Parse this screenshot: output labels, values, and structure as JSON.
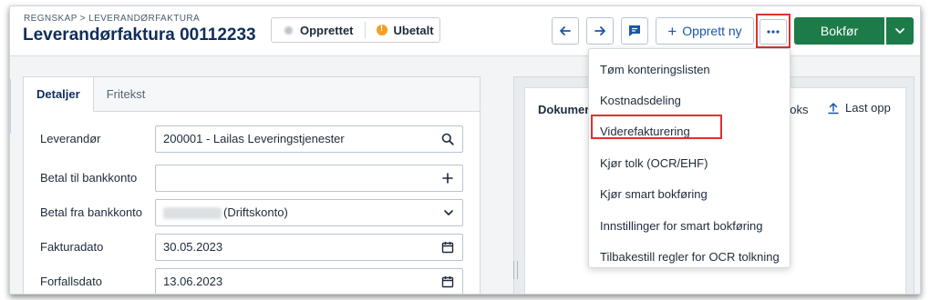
{
  "header": {
    "breadcrumb": "REGNSKAP > LEVERANDØRFAKTURA",
    "title": "Leverandørfaktura 00112233",
    "statuses": [
      {
        "label": "Opprettet",
        "icon": "circle-grey-icon"
      },
      {
        "label": "Ubetalt",
        "icon": "alert-orange-icon"
      }
    ],
    "actions": {
      "new_label": "Opprett ny",
      "primary_label": "Bokfør"
    }
  },
  "tabs": [
    {
      "label": "Detaljer",
      "active": true
    },
    {
      "label": "Fritekst",
      "active": false
    }
  ],
  "form": {
    "rows": [
      {
        "label": "Leverandør",
        "value": "200001 - Lailas Leveringstjenester",
        "icon": "search-icon"
      },
      {
        "label": "Betal til bankkonto",
        "value": "",
        "icon": "plus-icon"
      },
      {
        "label": "Betal fra bankkonto",
        "value": "(Driftskonto)",
        "icon": "chevron-down-icon"
      },
      {
        "label": "Fakturadato",
        "value": "30.05.2023",
        "icon": "calendar-icon"
      },
      {
        "label": "Forfallsdato",
        "value": "13.06.2023",
        "icon": "calendar-icon"
      }
    ]
  },
  "documents": {
    "title": "Dokumer",
    "books_fragment": "ooks",
    "upload_label": "Last opp"
  },
  "menu": {
    "items": [
      "Tøm konteringslisten",
      "Kostnadsdeling",
      "Viderefakturering",
      "Kjør tolk (OCR/EHF)",
      "Kjør smart bokføring",
      "Innstillinger for smart bokføring",
      "Tilbakestill regler for OCR tolkning"
    ],
    "highlighted_item": "Viderefakturering"
  },
  "colors": {
    "title": "#0e2d5c",
    "link_blue": "#1a56a8",
    "primary_green": "#1d7b4a",
    "highlight_red": "#e0312d",
    "warning_orange": "#f0a025"
  }
}
